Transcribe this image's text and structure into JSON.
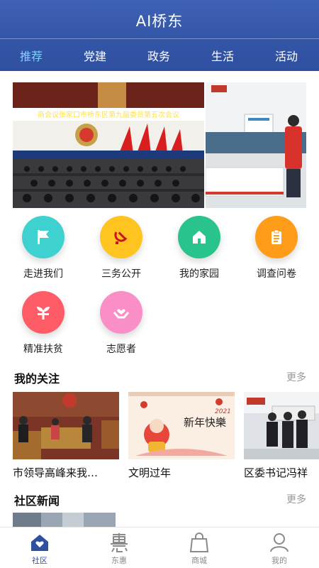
{
  "header": {
    "title": "AI桥东"
  },
  "tabs": [
    {
      "label": "推荐",
      "active": true
    },
    {
      "label": "党建"
    },
    {
      "label": "政务"
    },
    {
      "label": "生活"
    },
    {
      "label": "活动"
    }
  ],
  "banner": {
    "caption": "商会议张家口市桥东区第九届委员第五次会议"
  },
  "grid": [
    {
      "label": "走进我们",
      "icon": "flag-icon",
      "color": "#3fd1cf"
    },
    {
      "label": "三务公开",
      "icon": "hammer-sickle-icon",
      "color": "#ffc41f"
    },
    {
      "label": "我的家园",
      "icon": "house-icon",
      "color": "#28c48c"
    },
    {
      "label": "调查问卷",
      "icon": "clipboard-icon",
      "color": "#ff9d1a"
    },
    {
      "label": "精准扶贫",
      "icon": "sprout-icon",
      "color": "#ff5c68"
    },
    {
      "label": "志愿者",
      "icon": "heart-hands-icon",
      "color": "#f98fc6"
    }
  ],
  "my_follow": {
    "title": "我的关注",
    "more": "更多",
    "cards": [
      {
        "title": "市领导高峰来我…"
      },
      {
        "title": "文明过年",
        "image_text": "新年快樂",
        "image_year": "2021"
      },
      {
        "title": "区委书记冯祥"
      }
    ]
  },
  "community_news": {
    "title": "社区新闻",
    "more": "更多"
  },
  "bottom_nav": [
    {
      "label": "社区",
      "icon": "home-heart-icon",
      "active": true
    },
    {
      "label": "东惠",
      "icon": "hui-glyph-icon"
    },
    {
      "label": "商城",
      "icon": "shopping-bag-icon"
    },
    {
      "label": "我的",
      "icon": "user-icon"
    }
  ]
}
